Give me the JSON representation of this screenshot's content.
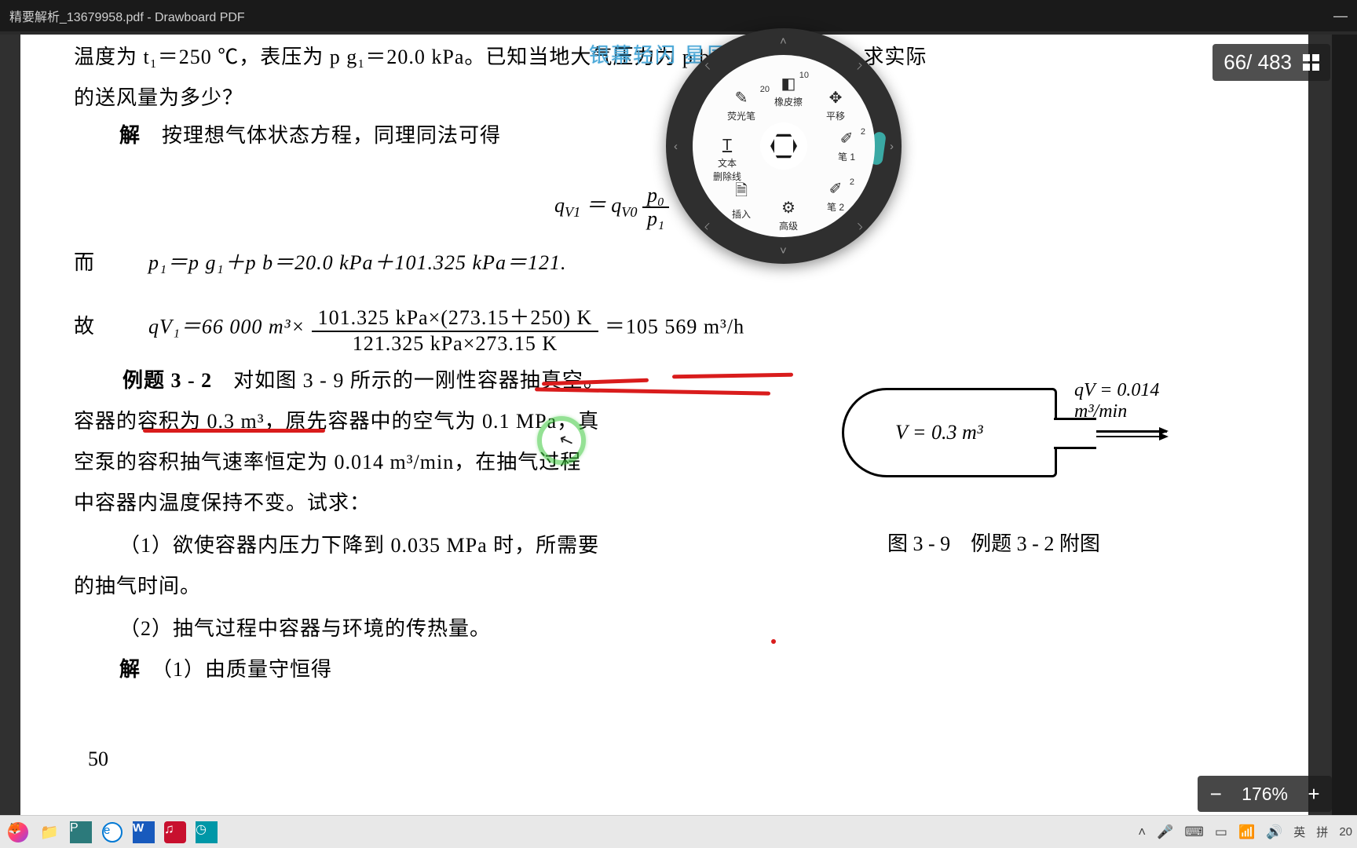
{
  "window": {
    "title": "精要解析_13679958.pdf - Drawboard PDF",
    "minimize": "—"
  },
  "watermark": "银幕轻闪 星辰旋转",
  "pagecounter": {
    "current": "66",
    "sep": "/ ",
    "total": "483"
  },
  "zoom": {
    "minus": "−",
    "value": "176%",
    "plus": "+"
  },
  "replay_icon": "↻",
  "doc": {
    "l0": "温度为 t₁＝250 ℃，表压为 p g₁＝20.0 kPa。已知当地大气压力为 p b＝101.325 kPa，求实际",
    "l1": "的送风量为多少？",
    "l2_pre": "解",
    "l2": "　按理想气体状态方程，同理同法可得",
    "eq1_lhs": "q",
    "eq1_sub1": "V1",
    "eq1_eq": " ＝ q",
    "eq1_sub2": "V0",
    "eq1_num": "p₀",
    "eq1_den": "p₁",
    "l3_pre": "而",
    "l3": "p₁＝p g₁＋p b＝20.0 kPa＋101.325 kPa＝121.",
    "l4_pre": "故",
    "l4a": "qV₁＝66 000 m³×",
    "l4_num": "101.325 kPa×(273.15＋250) K",
    "l4_den": "121.325 kPa×273.15 K",
    "l4b": "＝105 569 m³/h",
    "l5_pre": "例题 3 - 2",
    "l5": "　对如图 3 - 9 所示的一刚性容器抽真空。",
    "l6": "容器的容积为 0.3 m³，原先容器中的空气为 0.1 MPa，真",
    "l7": "空泵的容积抽气速率恒定为 0.014 m³/min，在抽气过程",
    "l8": "中容器内温度保持不变。试求：",
    "l9": "（1）欲使容器内压力下降到 0.035 MPa 时，所需要",
    "l10": "的抽气时间。",
    "l11": "（2）抽气过程中容器与环境的传热量。",
    "l12_pre": "解",
    "l12": "　（1）由质量守恒得",
    "pagenum": "50",
    "fig": {
      "V": "V = 0.3 m³",
      "qv": "qV = 0.014 m³/min",
      "caption": "图 3 - 9　例题 3 - 2 附图"
    }
  },
  "wheel": {
    "highlighter": "荧光笔",
    "highlighter_n": "20",
    "eraser": "橡皮擦",
    "eraser_n": "10",
    "pan": "平移",
    "strike": "文本\n删除线",
    "pen1": "笔 1",
    "pen1_n": "2",
    "insert": "插入",
    "advanced": "高级",
    "pen2": "笔 2",
    "pen2_n": "2"
  },
  "taskbar": {
    "ime_lang": "英",
    "ime_mode": "拼",
    "time": "20"
  }
}
